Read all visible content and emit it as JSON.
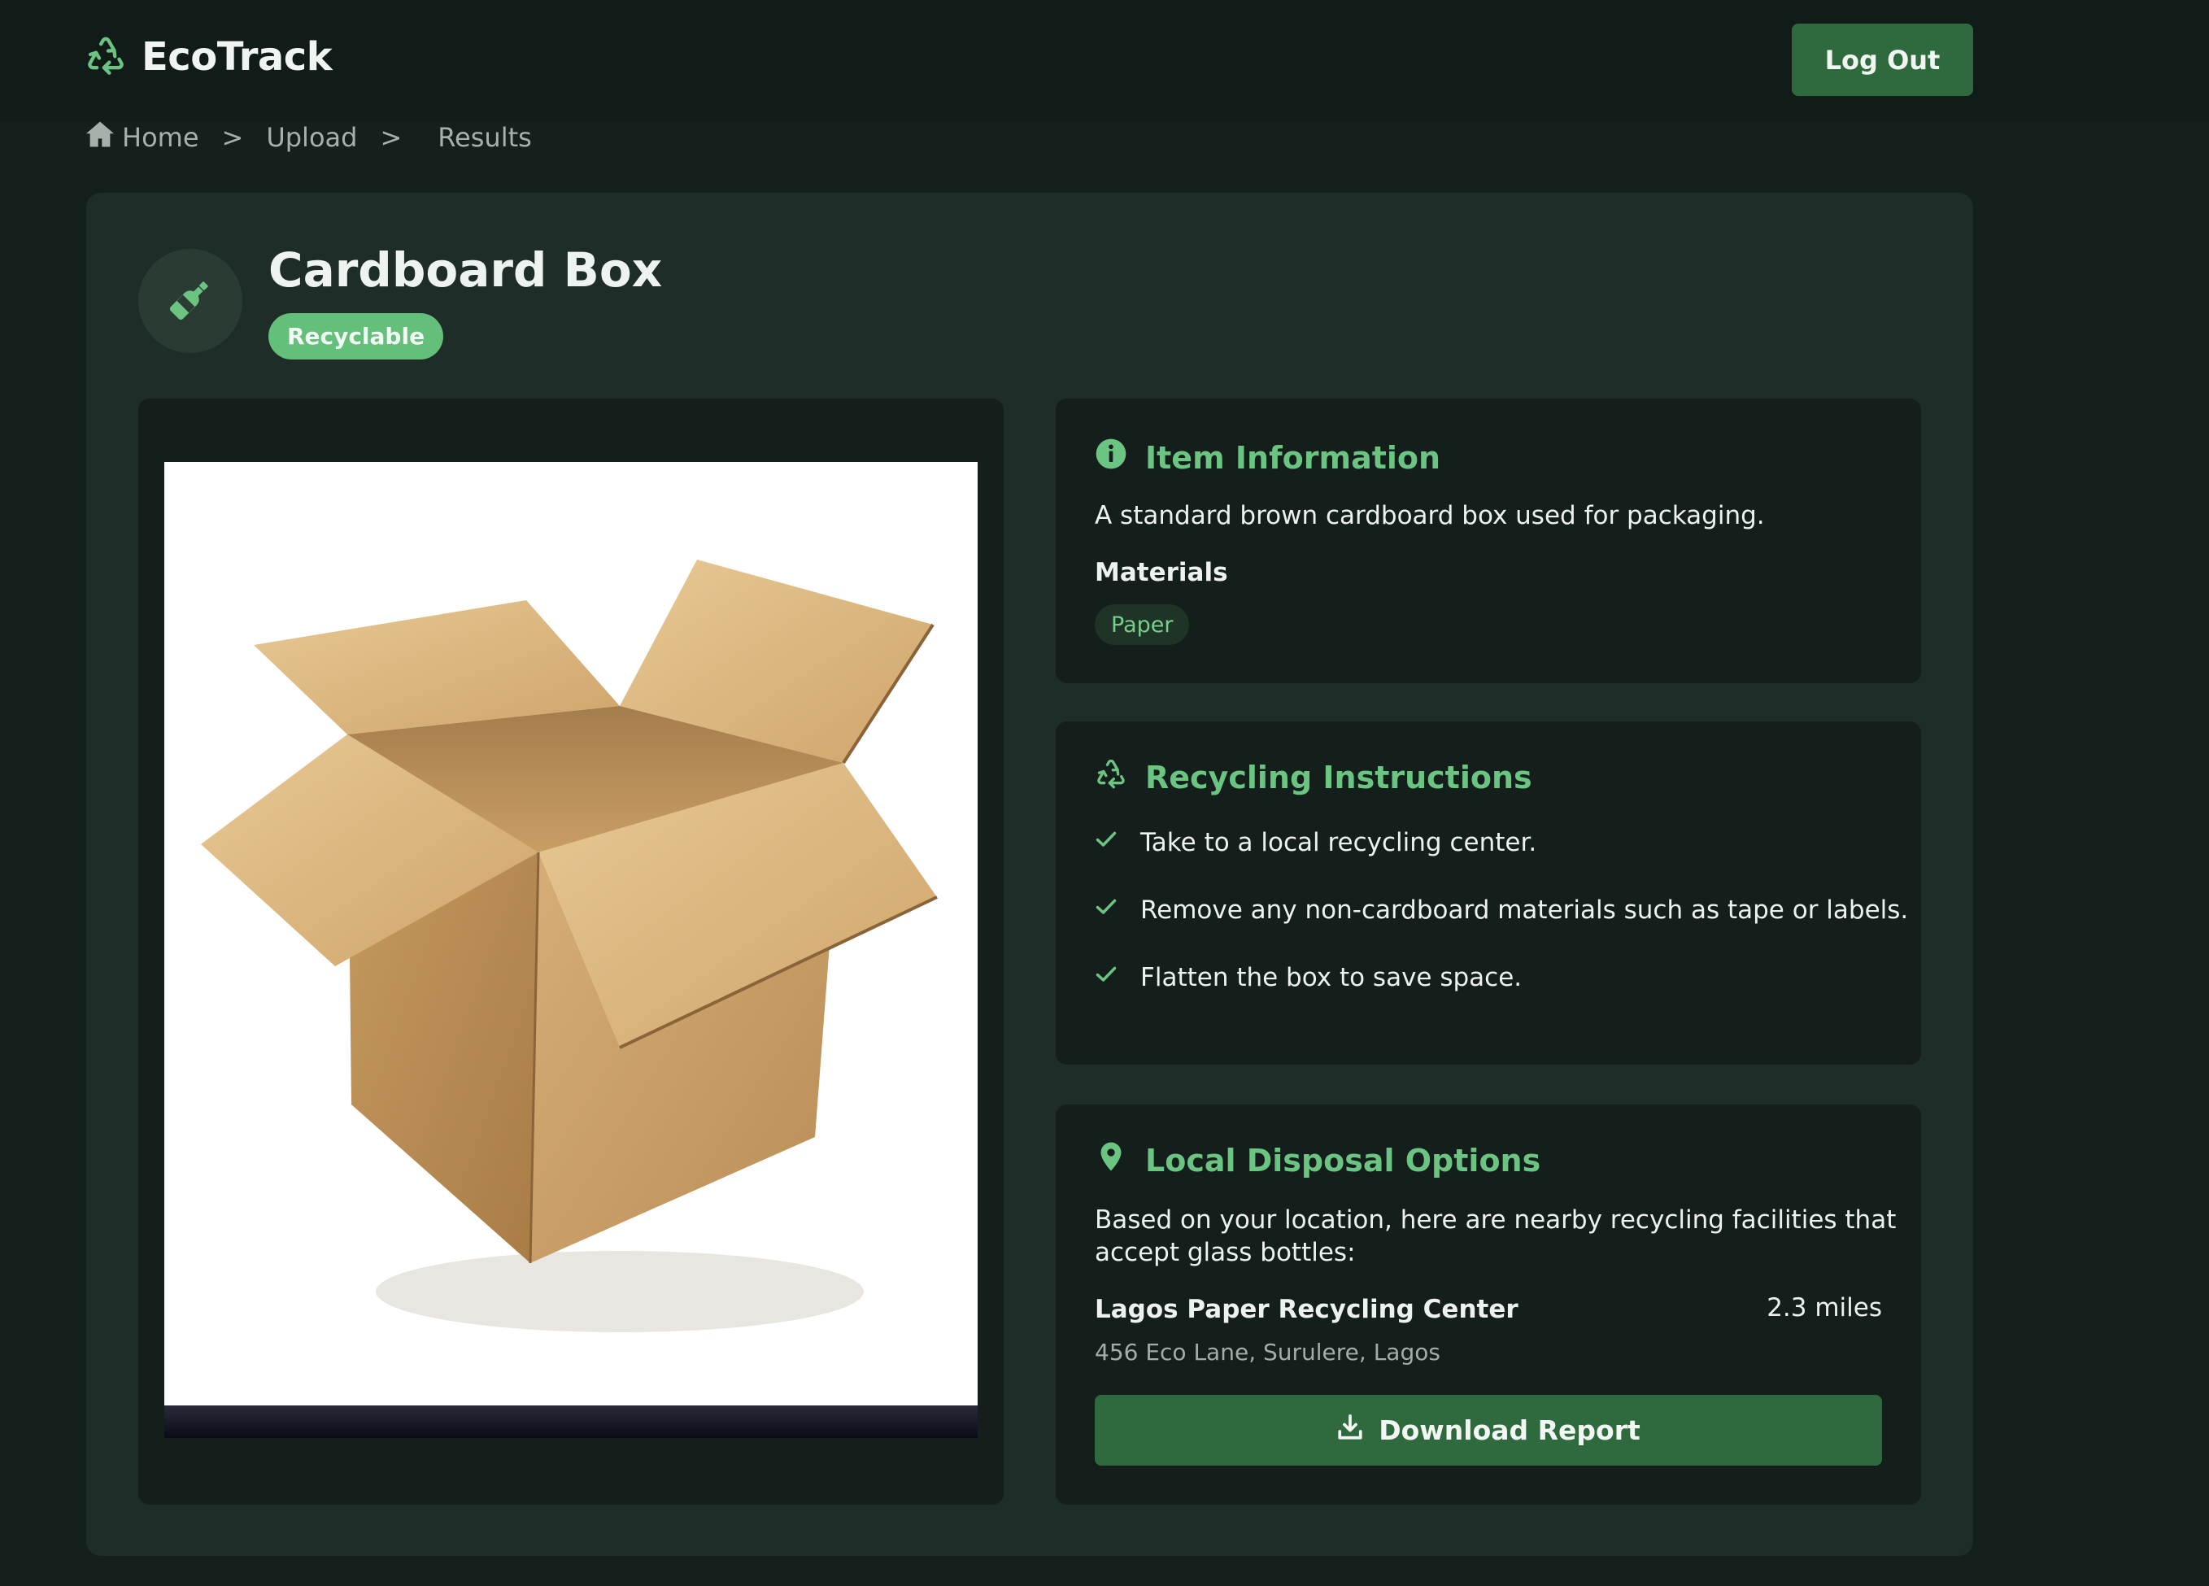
{
  "app": {
    "name": "EcoTrack"
  },
  "header": {
    "logout_label": "Log Out"
  },
  "breadcrumb": {
    "home": "Home",
    "sep1": ">",
    "upload": "Upload",
    "sep2": ">",
    "results": "Results"
  },
  "item": {
    "title": "Cardboard Box",
    "status": "Recyclable",
    "icon": "bottle-icon"
  },
  "item_info": {
    "heading": "Item Information",
    "description": "A standard brown cardboard box used for packaging.",
    "materials_label": "Materials",
    "materials": [
      "Paper"
    ]
  },
  "recycling": {
    "heading": "Recycling Instructions",
    "steps": [
      "Take to a local recycling center.",
      "Remove any non-cardboard materials such as tape or labels.",
      "Flatten the box to save space."
    ]
  },
  "disposal": {
    "heading": "Local Disposal Options",
    "intro_line1": "Based on your location, here are nearby recycling facilities that",
    "intro_line2": "accept glass bottles:",
    "facility": {
      "name": "Lagos Paper Recycling Center",
      "distance": "2.3 miles",
      "address": "456 Eco Lane, Surulere, Lagos"
    },
    "download_label": "Download Report"
  },
  "colors": {
    "accent": "#6cc483",
    "button": "#2f6a3e",
    "background": "#13201b",
    "panel": "#1f2d28",
    "card": "#141e1a"
  }
}
